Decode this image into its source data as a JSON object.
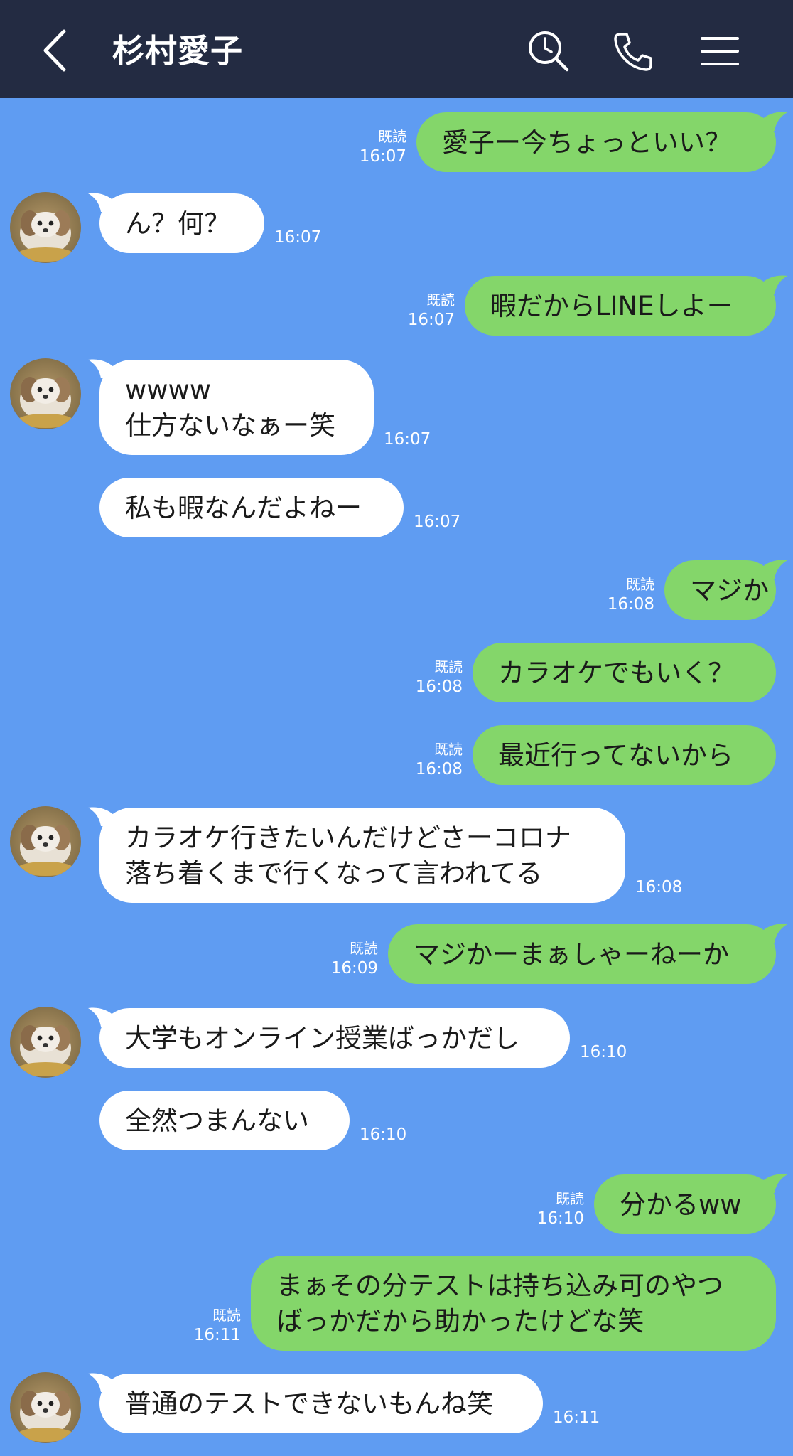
{
  "header": {
    "title": "杉村愛子",
    "icons": [
      "back-arrow-icon",
      "search-clock-icon",
      "phone-icon",
      "menu-icon"
    ],
    "background": "#232b42"
  },
  "colors": {
    "chat_background": "#5f9cf2",
    "outgoing_bubble": "#84d66a",
    "incoming_bubble": "#ffffff"
  },
  "messages": [
    {
      "dir": "out",
      "text": "愛子ー今ちょっといい？",
      "read": "既読",
      "time": "16:07"
    },
    {
      "dir": "in",
      "text": "ん？何？",
      "time": "16:07",
      "avatar": true
    },
    {
      "dir": "out",
      "text": "暇だからLINEしよー",
      "read": "既読",
      "time": "16:07"
    },
    {
      "dir": "in",
      "lines": [
        "wwww",
        "仕方ないなぁー笑"
      ],
      "time": "16:07",
      "avatar": true
    },
    {
      "dir": "in",
      "text": "私も暇なんだよねー",
      "time": "16:07"
    },
    {
      "dir": "out",
      "text": "マジか",
      "read": "既読",
      "time": "16:08"
    },
    {
      "dir": "out",
      "text": "カラオケでもいく？",
      "read": "既読",
      "time": "16:08"
    },
    {
      "dir": "out",
      "text": "最近行ってないから",
      "read": "既読",
      "time": "16:08"
    },
    {
      "dir": "in",
      "lines": [
        "カラオケ行きたいんだけどさーコロナ",
        "落ち着くまで行くなって言われてる"
      ],
      "time": "16:08",
      "avatar": true
    },
    {
      "dir": "out",
      "text": "マジかーまぁしゃーねーか",
      "read": "既読",
      "time": "16:09"
    },
    {
      "dir": "in",
      "text": "大学もオンライン授業ばっかだし",
      "time": "16:10",
      "avatar": true
    },
    {
      "dir": "in",
      "text": "全然つまんない",
      "time": "16:10"
    },
    {
      "dir": "out",
      "text": "分かるww",
      "read": "既読",
      "time": "16:10"
    },
    {
      "dir": "out",
      "lines": [
        "まぁその分テストは持ち込み可のやつ",
        "ばっかだから助かったけどな笑"
      ],
      "read": "既読",
      "time": "16:11"
    },
    {
      "dir": "in",
      "text": "普通のテストできないもんね笑",
      "time": "16:11",
      "avatar": true
    }
  ]
}
